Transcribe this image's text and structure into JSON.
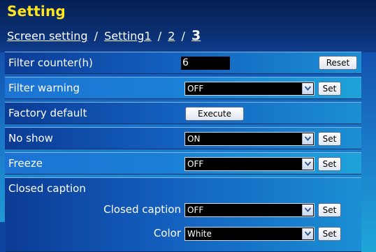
{
  "header": {
    "title": "Setting",
    "breadcrumb": {
      "screen_setting": "Screen setting",
      "sep1": "/",
      "setting1": "Setting1",
      "sep2": "/",
      "page2": "2",
      "sep3": "/",
      "page3": "3"
    }
  },
  "rows": {
    "filter_counter": {
      "label": "Filter counter(h)",
      "value": "6",
      "button": "Reset"
    },
    "filter_warning": {
      "label": "Filter warning",
      "selected": "OFF",
      "button": "Set"
    },
    "factory_default": {
      "label": "Factory default",
      "button": "Execute"
    },
    "no_show": {
      "label": "No show",
      "selected": "ON",
      "button": "Set"
    },
    "freeze": {
      "label": "Freeze",
      "selected": "OFF",
      "button": "Set"
    },
    "closed_caption_group": {
      "label": "Closed caption"
    },
    "closed_caption": {
      "label": "Closed caption",
      "selected": "OFF",
      "button": "Set"
    },
    "color": {
      "label": "Color",
      "selected": "White",
      "button": "Set"
    }
  },
  "icons": {
    "dropdown": "chevron-down-icon"
  },
  "colors": {
    "title": "#ffe41e",
    "accent": "#1a7fd6",
    "header_bg": "#0a2d6e"
  }
}
